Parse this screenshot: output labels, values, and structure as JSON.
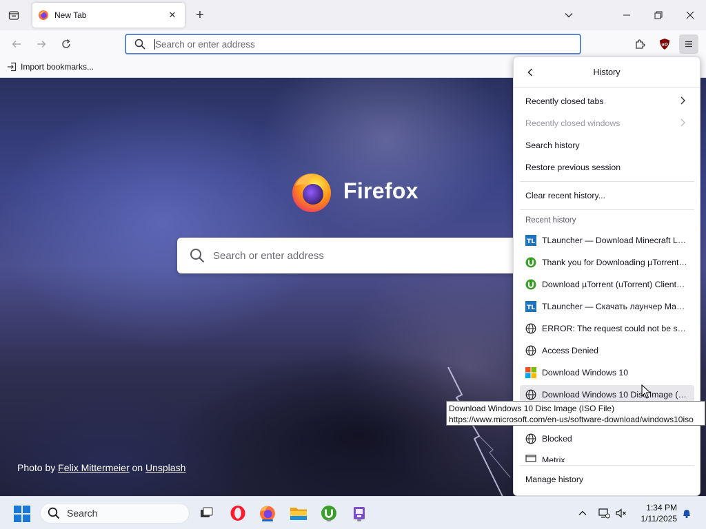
{
  "tabs": [
    {
      "title": "New Tab",
      "close_label": "✕"
    }
  ],
  "toolbar": {
    "new_tab_label": "+"
  },
  "urlbar": {
    "placeholder": "Search or enter address",
    "value": ""
  },
  "bookmarks": [
    {
      "label": "Import bookmarks..."
    }
  ],
  "newtab": {
    "brand": "Firefox",
    "search_placeholder": "Search or enter address",
    "credit": {
      "prefix": "Photo by",
      "author": "Felix Mittermeier",
      "middle": "on",
      "site": "Unsplash"
    }
  },
  "history_panel": {
    "title": "History",
    "items": [
      {
        "label": "Recently closed tabs",
        "enabled": true,
        "submenu": true
      },
      {
        "label": "Recently closed windows",
        "enabled": false,
        "submenu": true
      },
      {
        "label": "Search history",
        "enabled": true
      },
      {
        "label": "Restore previous session",
        "enabled": true
      }
    ],
    "clear_label": "Clear recent history...",
    "recent_header": "Recent history",
    "recent": [
      {
        "title": "TLauncher — Download Minecraft Launcher",
        "icon": "tlauncher-icon"
      },
      {
        "title": "Thank you for Downloading µTorrent (uTorrent)",
        "icon": "utorrent-icon"
      },
      {
        "title": "Download µTorrent (uTorrent) Clients for Windows",
        "icon": "utorrent-icon"
      },
      {
        "title": "TLauncher — Скачать лаунчер Майнкрафт",
        "icon": "tlauncher-icon"
      },
      {
        "title": "ERROR: The request could not be satisfied",
        "icon": "globe-icon"
      },
      {
        "title": "Access Denied",
        "icon": "globe-icon"
      },
      {
        "title": "Download Windows 10",
        "icon": "windows-logo-icon"
      },
      {
        "title": "Download Windows 10 Disc Image (ISO File)",
        "icon": "globe-icon"
      },
      {
        "title": "Blocked",
        "icon": "globe-icon"
      },
      {
        "title": "Metrix",
        "icon": "page-icon"
      }
    ],
    "manage_label": "Manage history"
  },
  "tooltip": {
    "title": "Download Windows 10 Disc Image (ISO File)",
    "url": "https://www.microsoft.com/en-us/software-download/windows10iso"
  },
  "taskbar": {
    "search_label": "Search",
    "time": "1:34 PM",
    "date": "1/11/2025"
  },
  "colors": {
    "urlbar_focus": "#5c8ad8",
    "taskbar_active": "#1a67c9",
    "tlauncher": "#1e73be",
    "utorrent": "#3aa02a"
  }
}
